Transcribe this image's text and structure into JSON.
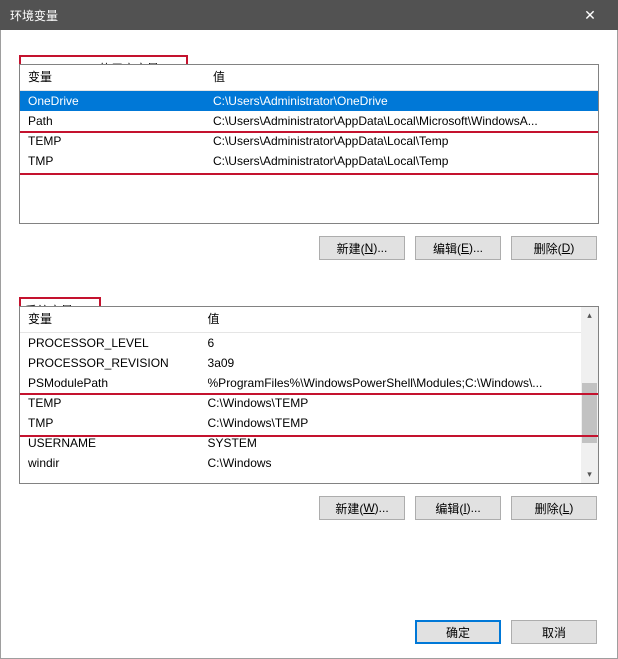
{
  "titlebar": {
    "title": "环境变量"
  },
  "user_section": {
    "label_prefix": "Administrator 的用户变量(",
    "label_hotkey": "U",
    "label_suffix": ")",
    "headers": {
      "name": "变量",
      "value": "值"
    },
    "rows": [
      {
        "name": "OneDrive",
        "value": "C:\\Users\\Administrator\\OneDrive",
        "selected": true
      },
      {
        "name": "Path",
        "value": "C:\\Users\\Administrator\\AppData\\Local\\Microsoft\\WindowsA..."
      },
      {
        "name": "TEMP",
        "value": "C:\\Users\\Administrator\\AppData\\Local\\Temp"
      },
      {
        "name": "TMP",
        "value": "C:\\Users\\Administrator\\AppData\\Local\\Temp"
      }
    ],
    "buttons": {
      "new_l": "新建(",
      "new_k": "N",
      "new_r": ")...",
      "edit_l": "编辑(",
      "edit_k": "E",
      "edit_r": ")...",
      "del_l": "删除(",
      "del_k": "D",
      "del_r": ")"
    }
  },
  "system_section": {
    "label_prefix": "系统变量(",
    "label_hotkey": "S",
    "label_suffix": ")",
    "headers": {
      "name": "变量",
      "value": "值"
    },
    "rows": [
      {
        "name": "PROCESSOR_LEVEL",
        "value": "6"
      },
      {
        "name": "PROCESSOR_REVISION",
        "value": "3a09"
      },
      {
        "name": "PSModulePath",
        "value": "%ProgramFiles%\\WindowsPowerShell\\Modules;C:\\Windows\\..."
      },
      {
        "name": "TEMP",
        "value": "C:\\Windows\\TEMP"
      },
      {
        "name": "TMP",
        "value": "C:\\Windows\\TEMP"
      },
      {
        "name": "USERNAME",
        "value": "SYSTEM"
      },
      {
        "name": "windir",
        "value": "C:\\Windows"
      }
    ],
    "buttons": {
      "new_l": "新建(",
      "new_k": "W",
      "new_r": ")...",
      "edit_l": "编辑(",
      "edit_k": "I",
      "edit_r": ")...",
      "del_l": "删除(",
      "del_k": "L",
      "del_r": ")"
    }
  },
  "dialog_buttons": {
    "ok": "确定",
    "cancel": "取消"
  }
}
